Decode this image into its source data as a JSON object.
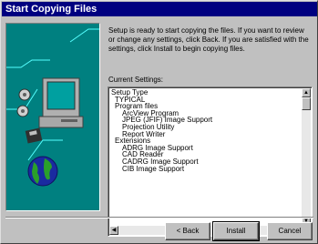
{
  "window": {
    "title": "Start Copying Files"
  },
  "intro": {
    "text": "Setup is ready to start copying the files.  If you want to review or change any settings, click Back.  If you are satisfied with the settings, click Install to begin copying files."
  },
  "settings": {
    "label": "Current Settings:",
    "items": [
      "Setup Type",
      "    TYPICAL",
      "    Program files",
      "        ArcView Program",
      "        JPEG (JFIF) Image Support",
      "        Projection Utility",
      "        Report Writer",
      "    Extensions",
      "        ADRG Image Support",
      "        CAD Reader",
      "        CADRG Image Support",
      "        CIB Image Support"
    ]
  },
  "buttons": {
    "back": "< Back",
    "install": "Install",
    "cancel": "Cancel"
  },
  "colors": {
    "titlebar": "#000080",
    "art_background": "#008080",
    "face": "#c0c0c0"
  }
}
